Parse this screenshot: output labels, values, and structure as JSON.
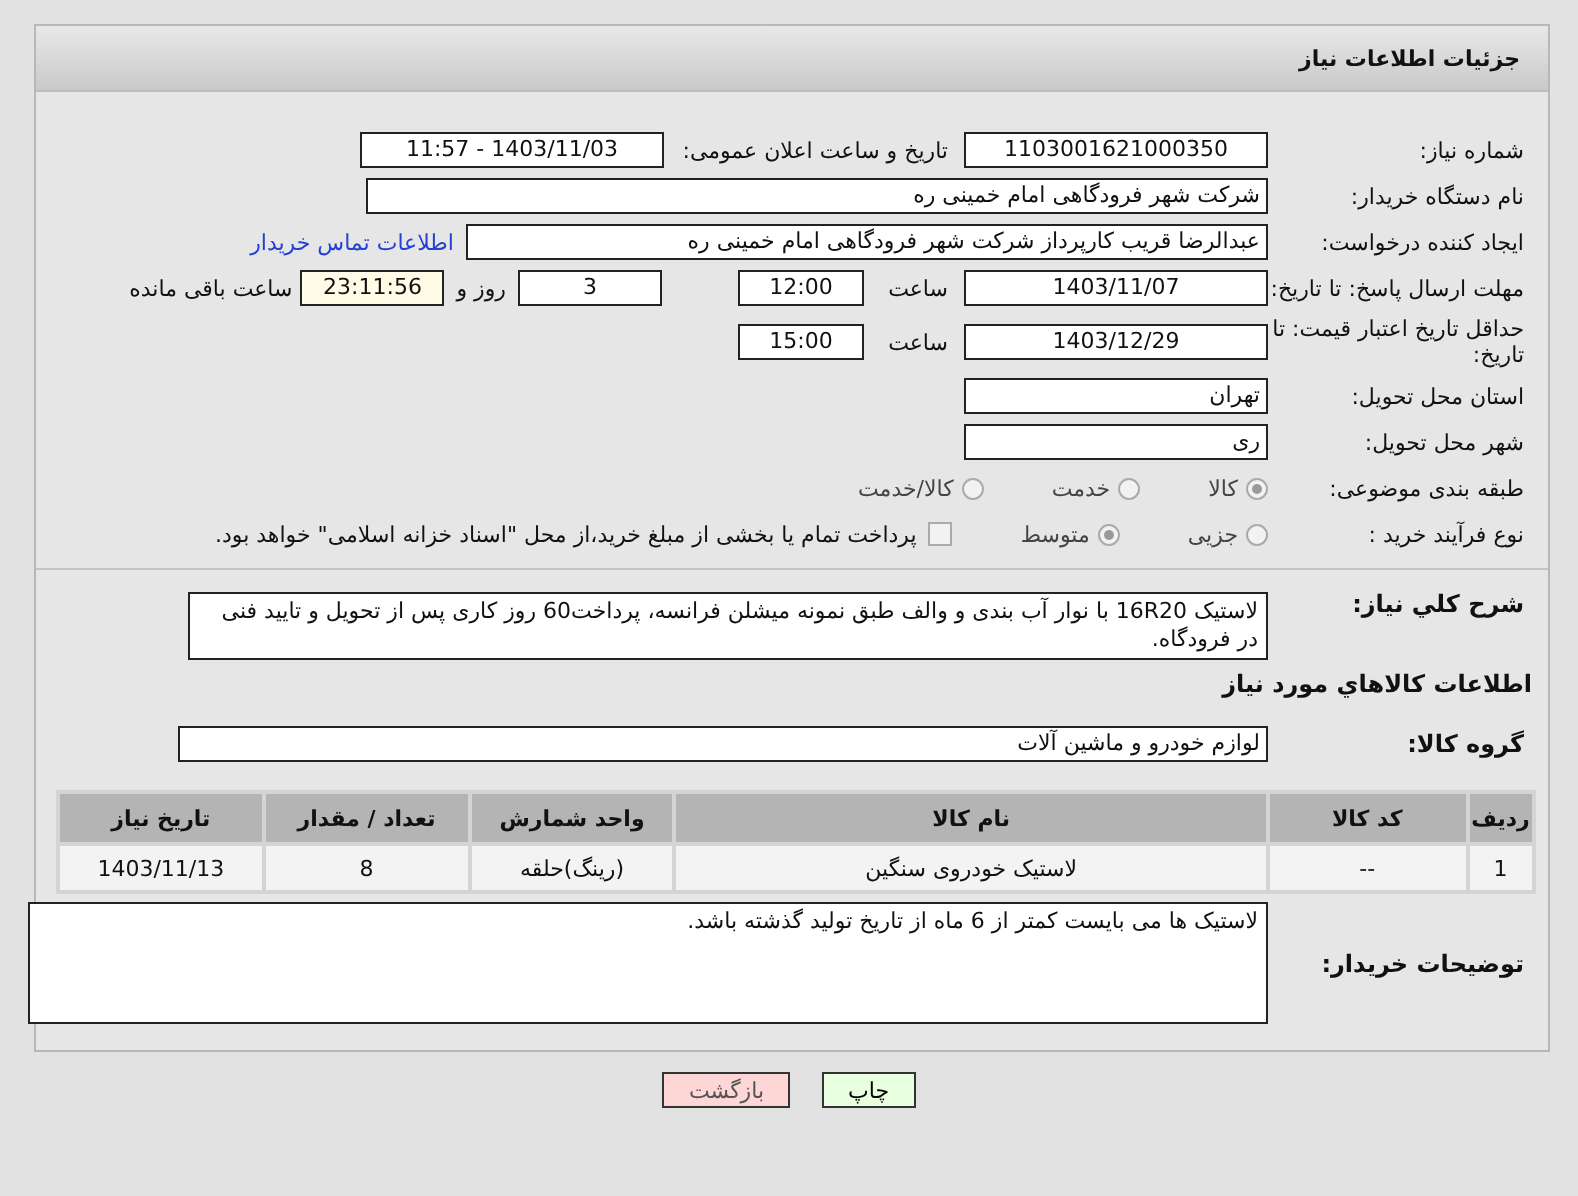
{
  "header": {
    "title": "جزئیات اطلاعات نیاز"
  },
  "need_number": {
    "label": "شماره نیاز:",
    "value": "1103001621000350"
  },
  "announce": {
    "label": "تاریخ و ساعت اعلان عمومی:",
    "value": "1403/11/03 - 11:57"
  },
  "buyer_org": {
    "label": "نام دستگاه خریدار:",
    "value": "شرکت شهر فرودگاهی امام خمینی  ره"
  },
  "requester": {
    "label": "ایجاد کننده درخواست:",
    "value": "عبدالرضا قریب کارپرداز شرکت شهر فرودگاهی امام خمینی  ره",
    "link": "اطلاعات تماس خریدار"
  },
  "deadline": {
    "label": "مهلت ارسال پاسخ: تا تاریخ:",
    "date": "1403/11/07",
    "time_label": "ساعت",
    "time": "12:00",
    "days": "3",
    "days_label": "روز و",
    "remaining": "23:11:56",
    "remaining_label": "ساعت باقی مانده"
  },
  "price_validity": {
    "label": "حداقل تاریخ اعتبار قیمت: تا تاریخ:",
    "date": "1403/12/29",
    "time_label": "ساعت",
    "time": "15:00"
  },
  "province": {
    "label": "استان محل تحویل:",
    "value": "تهران"
  },
  "city": {
    "label": "شهر محل تحویل:",
    "value": "ری"
  },
  "category": {
    "label": "طبقه بندی موضوعی:",
    "options": [
      {
        "label": "کالا",
        "selected": true
      },
      {
        "label": "خدمت",
        "selected": false
      },
      {
        "label": "کالا/خدمت",
        "selected": false
      }
    ]
  },
  "process": {
    "label": "نوع فرآیند خرید :",
    "options": [
      {
        "label": "جزیی",
        "selected": false
      },
      {
        "label": "متوسط",
        "selected": true
      }
    ],
    "payment_note": {
      "text": "پرداخت تمام یا بخشی از مبلغ خرید،از محل \"اسناد خزانه اسلامی\" خواهد بود.",
      "checked": false
    }
  },
  "description": {
    "label": "شرح کلي نياز:",
    "value": "لاستیک 16R20 با نوار آب بندی و والف طبق نمونه میشلن فرانسه، پرداخت60 روز کاری پس از تحویل و تایید فنی در فرودگاه."
  },
  "goods_heading": "اطلاعات کالاهاي مورد نياز",
  "goods_group": {
    "label": "گروه کالا:",
    "value": "لوازم خودرو و ماشین آلات"
  },
  "table": {
    "columns": [
      "ردیف",
      "کد کالا",
      "نام کالا",
      "واحد شمارش",
      "تعداد / مقدار",
      "تاریخ نیاز"
    ],
    "rows": [
      [
        "1",
        "--",
        "لاستیک خودروی سنگین",
        "(رینگ)حلقه",
        "8",
        "1403/11/13"
      ]
    ]
  },
  "buyer_notes": {
    "label": "توضیحات خریدار:",
    "value": "لاستیک ها می بایست کمتر از 6 ماه از تاریخ تولید گذشته باشد."
  },
  "buttons": [
    {
      "label": "چاپ",
      "kind": "print"
    },
    {
      "label": "بازگشت",
      "kind": "back"
    }
  ]
}
